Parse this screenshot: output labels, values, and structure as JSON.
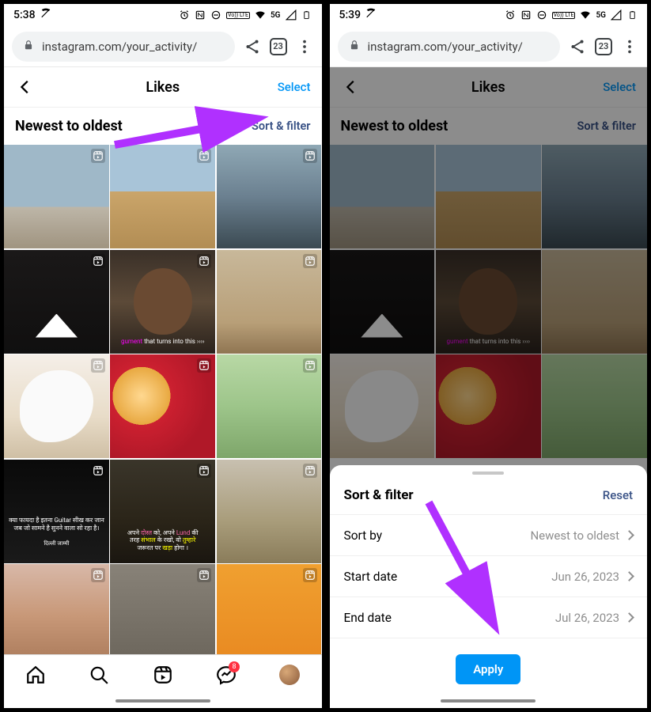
{
  "left": {
    "status": {
      "time": "5:38",
      "net": "5G",
      "volte": "Vo)) LTE"
    },
    "chrome": {
      "url": "instagram.com/your_activity/",
      "tabCount": "23"
    },
    "header": {
      "title": "Likes",
      "select": "Select"
    },
    "sort": {
      "label": "Newest to oldest",
      "link": "Sort & filter"
    },
    "nav": {
      "dmBadge": "8"
    }
  },
  "right": {
    "status": {
      "time": "5:39",
      "net": "5G",
      "volte": "Vo)) LTE"
    },
    "chrome": {
      "url": "instagram.com/your_activity/",
      "tabCount": "23"
    },
    "header": {
      "title": "Likes",
      "select": "Select"
    },
    "sort": {
      "label": "Newest to oldest",
      "link": "Sort & filter"
    },
    "sheet": {
      "title": "Sort & filter",
      "reset": "Reset",
      "sortByLabel": "Sort by",
      "sortByValue": "Newest to oldest",
      "startLabel": "Start date",
      "startValue": "Jun 26, 2023",
      "endLabel": "End date",
      "endValue": "Jul 26, 2023",
      "apply": "Apply"
    }
  }
}
